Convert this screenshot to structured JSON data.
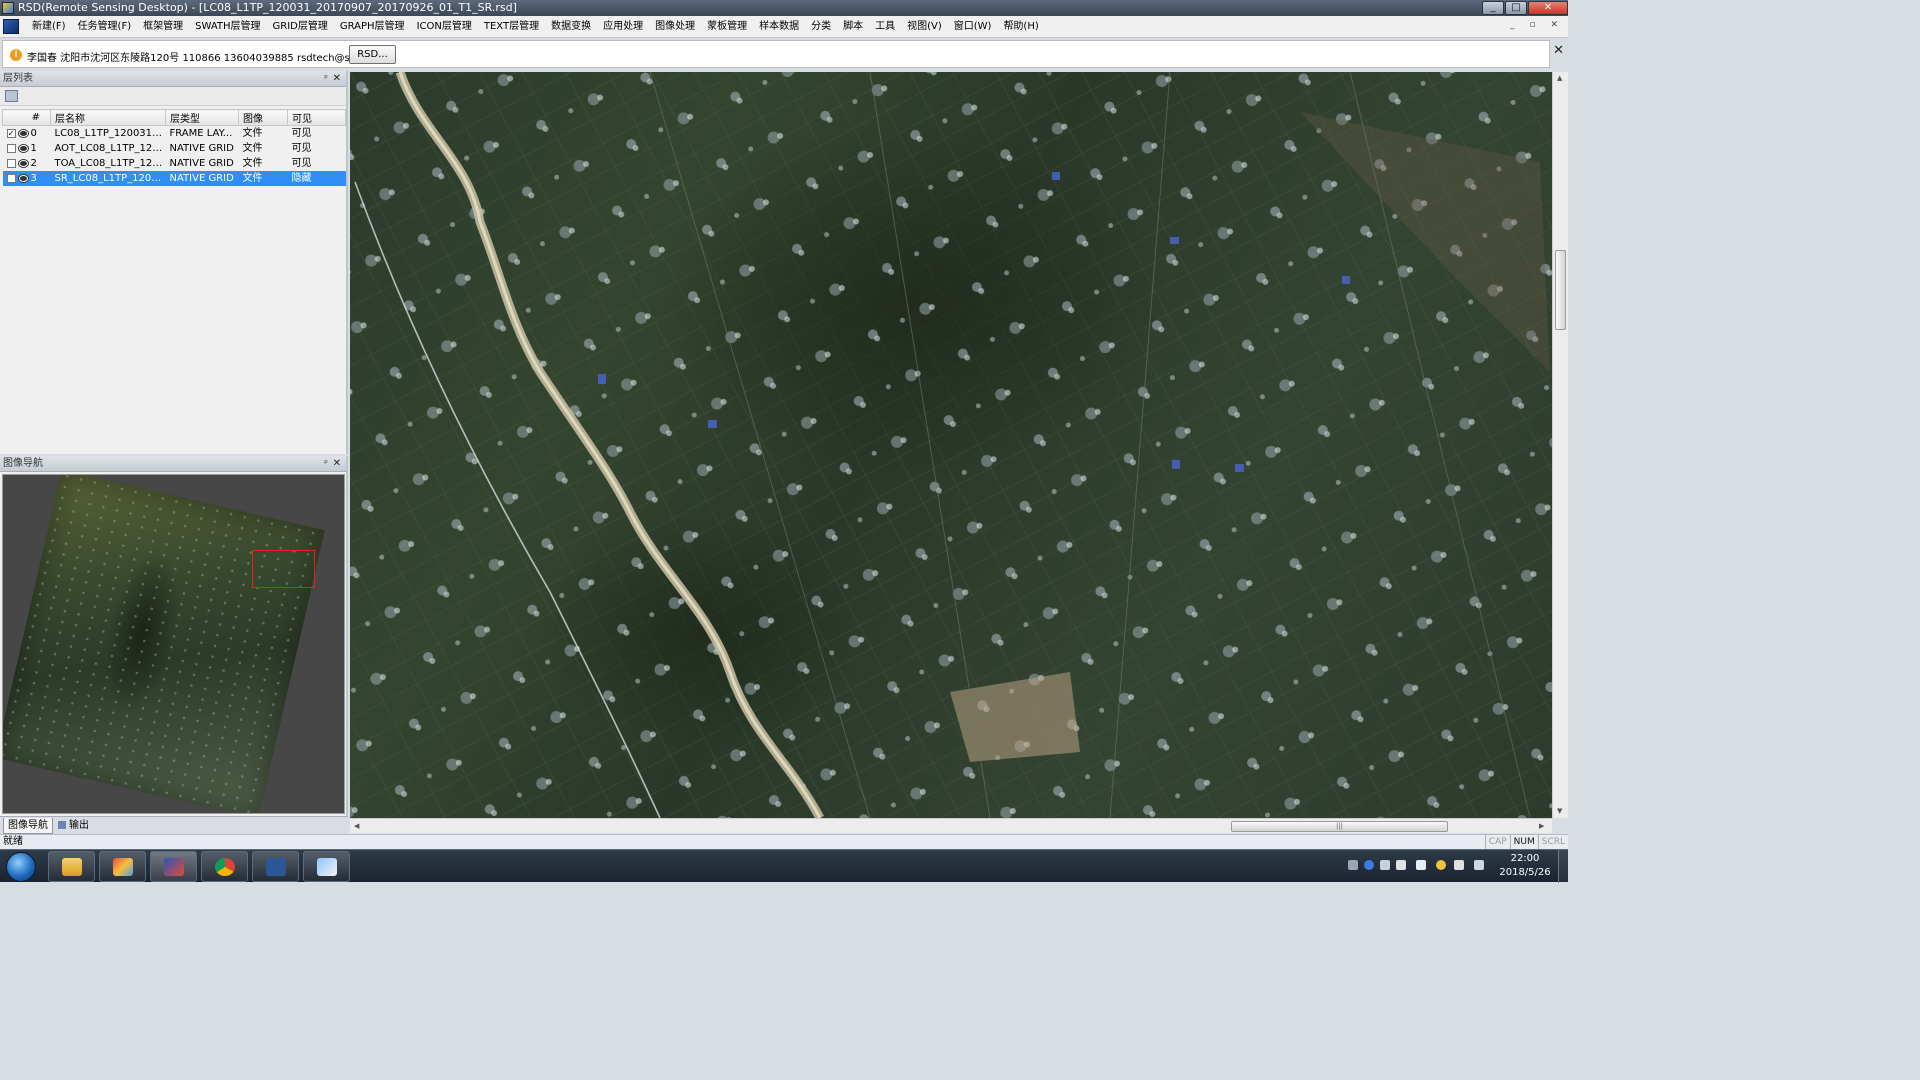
{
  "window": {
    "title": "RSD(Remote Sensing Desktop) - [LC08_L1TP_120031_20170907_20170926_01_T1_SR.rsd]",
    "minimize": "_",
    "maximize": "□",
    "close": "✕"
  },
  "menu": {
    "items": [
      "新建(F)",
      "任务管理(F)",
      "框架管理",
      "SWATH层管理",
      "GRID层管理",
      "GRAPH层管理",
      "ICON层管理",
      "TEXT层管理",
      "数据变换",
      "应用处理",
      "图像处理",
      "蒙板管理",
      "样本数据",
      "分类",
      "脚本",
      "工具",
      "视图(V)",
      "窗口(W)",
      "帮助(H)"
    ],
    "mdi_controls": "_ ▫ ✕"
  },
  "info_bar": {
    "icon": "i",
    "text": "李国春 沈阳市沈河区东陵路120号 110866 13604039885 rsdtech@sina.com",
    "button": "RSD...",
    "close": "✕"
  },
  "layer_panel": {
    "title": "层列表",
    "pin": "ᵖ",
    "close": "✕",
    "columns": [
      "#",
      "层名称",
      "层类型",
      "图像",
      "可见"
    ],
    "rows": [
      {
        "checked": true,
        "index": "0",
        "name": "LC08_L1TP_120031~...",
        "type": "FRAME LAY...",
        "image": "文件",
        "visible": "可见",
        "selected": false
      },
      {
        "checked": false,
        "index": "1",
        "name": "AOT_LC08_L1TP_120...",
        "type": "NATIVE GRID",
        "image": "文件",
        "visible": "可见",
        "selected": false
      },
      {
        "checked": false,
        "index": "2",
        "name": "TOA_LC08_L1TP_120...",
        "type": "NATIVE GRID",
        "image": "文件",
        "visible": "可见",
        "selected": false
      },
      {
        "checked": false,
        "index": "3",
        "name": "SR_LC08_L1TP_1200...",
        "type": "NATIVE GRID",
        "image": "文件",
        "visible": "隐藏",
        "selected": true
      }
    ]
  },
  "nav_panel": {
    "title": "图像导航",
    "pin": "ᵖ",
    "close": "✕"
  },
  "bottom_tabs": {
    "nav": "图像导航",
    "output": "输出"
  },
  "status": {
    "text": "就绪",
    "caps": "CAP",
    "num": "NUM",
    "scroll": "SCRL"
  },
  "taskbar": {
    "apps": [
      "file-explorer",
      "rsd-tool",
      "rsd-desktop",
      "chrome",
      "word",
      "paint"
    ],
    "time": "22:00",
    "date": "2018/5/26"
  },
  "colors": {
    "accent": "#2f8ff7",
    "nav_rect": "#e0241b",
    "title_bar": "#4a5668"
  }
}
